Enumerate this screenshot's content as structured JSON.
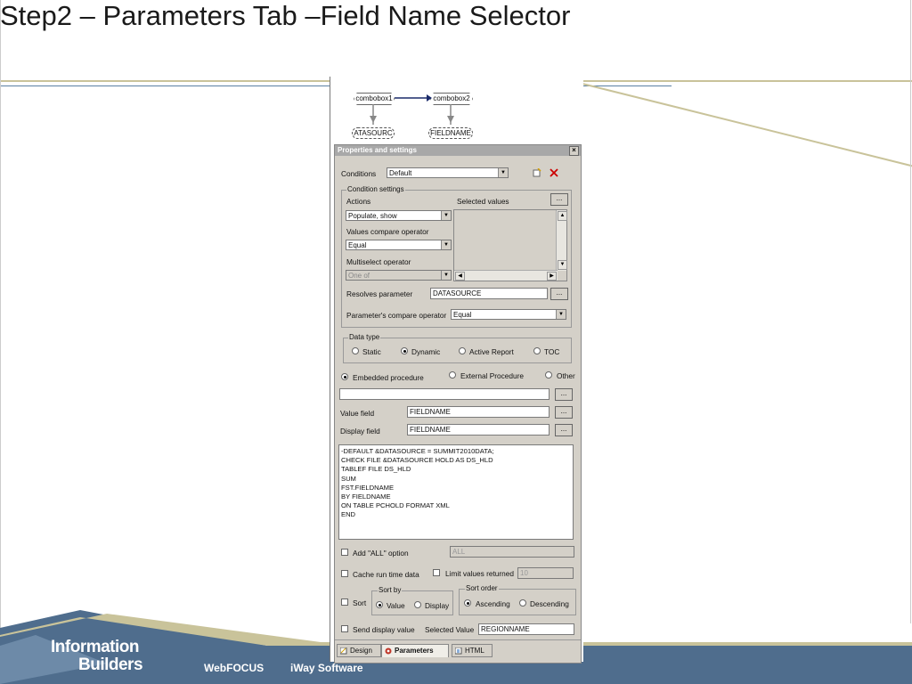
{
  "slide": {
    "title": "Step2 – Parameters Tab –Field Name Selector",
    "footer": {
      "logo_line1": "Information",
      "logo_line2": "Builders",
      "product1": "WebFOCUS",
      "product2": "iWay Software"
    }
  },
  "canvas": {
    "nodes": [
      {
        "label": "combobox1"
      },
      {
        "label": "combobox2"
      },
      {
        "label": "ATASOURC"
      },
      {
        "label": "FIELDNAME"
      }
    ]
  },
  "panel": {
    "title": "Properties and settings",
    "close": "×",
    "conditions_label": "Conditions",
    "conditions_value": "Default",
    "condition_settings_label": "Condition settings",
    "actions_label": "Actions",
    "actions_value": "Populate, show",
    "selected_values_label": "Selected values",
    "values_compare_label": "Values compare operator",
    "values_compare_value": "Equal",
    "multiselect_label": "Multiselect operator",
    "multiselect_value": "One of",
    "resolves_label": "Resolves parameter",
    "resolves_value": "DATASOURCE",
    "param_compare_label": "Parameter's compare operator",
    "param_compare_value": "Equal",
    "data_type_label": "Data type",
    "data_types": [
      "Static",
      "Dynamic",
      "Active Report",
      "TOC"
    ],
    "data_type_selected": "Dynamic",
    "procedure_options": [
      "Embedded procedure",
      "External Procedure",
      "Other"
    ],
    "procedure_selected": "Embedded procedure",
    "procedure_path": "",
    "value_field_label": "Value field",
    "value_field_value": "FIELDNAME",
    "display_field_label": "Display field",
    "display_field_value": "FIELDNAME",
    "procedure_code": "-DEFAULT &DATASOURCE = SUMMIT2010DATA;\nCHECK FILE &DATASOURCE HOLD AS DS_HLD\nTABLEF FILE DS_HLD\nSUM\nFST.FIELDNAME\nBY FIELDNAME\nON TABLE PCHOLD FORMAT XML\nEND",
    "add_all_label": "Add \"ALL\" option",
    "add_all_value": "ALL",
    "cache_label": "Cache run time data",
    "limit_label": "Limit values returned",
    "limit_value": "10",
    "sort_label": "Sort",
    "sort_by_label": "Sort by",
    "sort_by_options": [
      "Value",
      "Display"
    ],
    "sort_by_selected": "Value",
    "sort_order_label": "Sort order",
    "sort_order_options": [
      "Ascending",
      "Descending"
    ],
    "sort_order_selected": "Ascending",
    "send_display_label": "Send display value",
    "selected_value_label": "Selected Value",
    "selected_value_value": "REGIONNAME",
    "browse": "...",
    "tabs": [
      "Design",
      "Parameters",
      "HTML"
    ],
    "active_tab": "Parameters"
  },
  "colors": {
    "footer_blue": "#4f6d8d",
    "panel_gray": "#d4d0c8",
    "rule_gold": "#c9c39a",
    "rule_blue": "#5a7fa3",
    "delete_red": "#cc0000"
  }
}
